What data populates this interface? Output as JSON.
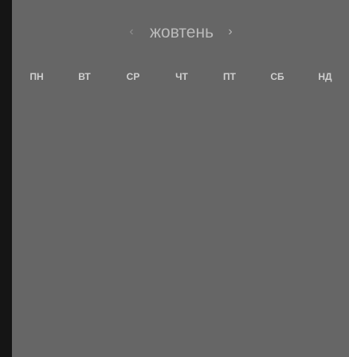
{
  "calendar": {
    "month": "жовтень",
    "nav": {
      "prev_icon": "chevron-left-icon",
      "next_icon": "chevron-right-icon"
    },
    "weekdays": [
      "ПН",
      "ВТ",
      "СР",
      "ЧТ",
      "ПТ",
      "СБ",
      "НД"
    ]
  },
  "colors": {
    "panel_background": "#666666",
    "left_strip": "#151515",
    "month_text": "#bababa",
    "weekday_text": "#cfcfcf",
    "arrow_text": "#a7a7a7"
  }
}
